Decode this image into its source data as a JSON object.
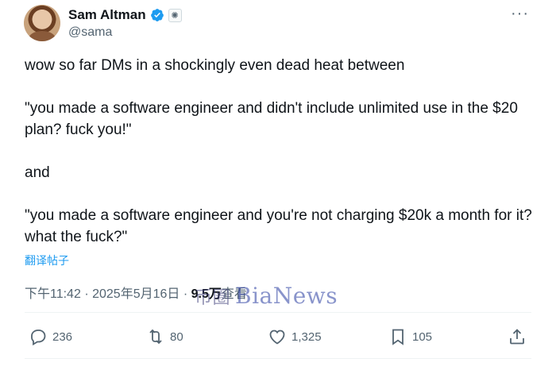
{
  "author": {
    "name": "Sam Altman",
    "handle": "@sama",
    "verified": true
  },
  "tweet": {
    "p1": "wow so far DMs in a shockingly even dead heat between",
    "p2": "\"you made a software engineer and didn't include unlimited use in the $20 plan? fuck you!\"",
    "p3": "and",
    "p4": "\"you made a software engineer and you're not charging $20k a month for it? what the fuck?\""
  },
  "translate_label": "翻译帖子",
  "meta": {
    "time": "下午11:42",
    "separator": "·",
    "date": "2025年5月16日",
    "views_count": "9.5万",
    "views_label": "查看"
  },
  "watermark": {
    "cn": "币圈",
    "en": "BiaNews"
  },
  "actions": {
    "replies": "236",
    "reposts": "80",
    "likes": "1,325",
    "bookmarks": "105"
  },
  "colors": {
    "text": "#0f1419",
    "secondary": "#536471",
    "link": "#1d9bf0",
    "verified": "#1d9bf0"
  }
}
